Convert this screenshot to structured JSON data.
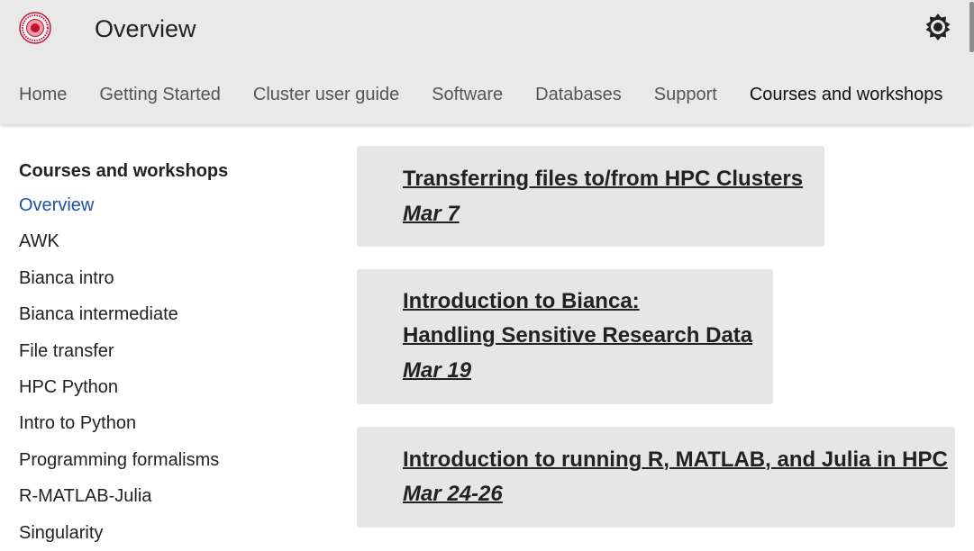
{
  "header": {
    "title": "Overview",
    "brand_color": "#c8102e",
    "theme_icon": "brightness-icon"
  },
  "nav": {
    "tabs": [
      {
        "label": "Home"
      },
      {
        "label": "Getting Started"
      },
      {
        "label": "Cluster user guide"
      },
      {
        "label": "Software"
      },
      {
        "label": "Databases"
      },
      {
        "label": "Support"
      },
      {
        "label": "Courses and workshops",
        "active": true
      }
    ]
  },
  "sidebar": {
    "heading": "Courses and workshops",
    "active_color": "#1f4fa3",
    "items": [
      {
        "label": "Overview",
        "active": true
      },
      {
        "label": "AWK"
      },
      {
        "label": "Bianca intro"
      },
      {
        "label": "Bianca intermediate"
      },
      {
        "label": "File transfer"
      },
      {
        "label": "HPC Python"
      },
      {
        "label": "Intro to Python"
      },
      {
        "label": "Programming formalisms"
      },
      {
        "label": "R-MATLAB-Julia"
      },
      {
        "label": "Singularity"
      }
    ]
  },
  "events": [
    {
      "title_lines": [
        "Transferring files to/from HPC Clusters"
      ],
      "date": "Mar 7"
    },
    {
      "title_lines": [
        "Introduction to Bianca:",
        "Handling Sensitive Research Data"
      ],
      "date": "Mar 19"
    },
    {
      "title_lines": [
        "Introduction to running R, MATLAB, and Julia in HPC"
      ],
      "date": "Mar 24-26"
    }
  ]
}
